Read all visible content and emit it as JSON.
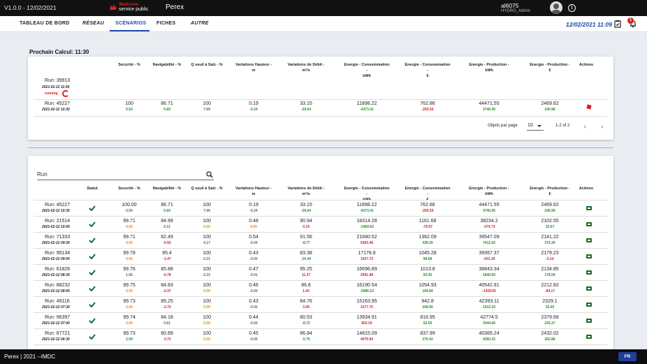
{
  "topbar": {
    "version": "V1.0.0 - 12/02/2021",
    "logo_line1": "Wallonie",
    "logo_line2": "service public",
    "app_name": "Perex",
    "user": "al6075",
    "role": "HYDRO_Admin"
  },
  "nav": {
    "tabs": [
      {
        "label": "TABLEAU DE BORD"
      },
      {
        "label": "RÉSEAU"
      },
      {
        "label": "SCÉNARIOS"
      },
      {
        "label": "FICHES"
      },
      {
        "label": "AUTRE"
      }
    ],
    "datetime": "12/02/2021 11:09",
    "notification_count": "1"
  },
  "page_title": "Prochain Calcul: 11:30",
  "columns": [
    "Securité - %",
    "Navigabilité - %",
    "Q seuil à Salz - %",
    "Variations Hauteur - m",
    "Variations de Débit - m³/s",
    "Energie - Consommation - kWh",
    "Energie - Consommation - €",
    "Energie - Production - kWh",
    "Energie - Production - €"
  ],
  "actions_header": "Actions",
  "status_header": "Statut",
  "upcoming": {
    "pending_run": {
      "name": "Run: 39913",
      "date": "2021-02-12 11:00",
      "status": "running"
    },
    "rows": [
      {
        "name": "Run: 45227",
        "date": "2021-02-12 10:30",
        "cells": [
          [
            "100",
            "0.50",
            "green"
          ],
          [
            "86.71",
            "5.69",
            "green"
          ],
          [
            "100",
            "7.99",
            "green"
          ],
          [
            "0.19",
            "-0.24",
            "green"
          ],
          [
            "33.15",
            "-29.64",
            "green"
          ],
          [
            "11898.22",
            "-4373.41",
            "green"
          ],
          [
            "762.86",
            "-265.55",
            "red"
          ],
          [
            "44471.55",
            "3740.05",
            "green"
          ],
          [
            "2469.62",
            "240.96",
            "green"
          ]
        ]
      }
    ],
    "pager": {
      "label": "Objets par page",
      "per_page": "10",
      "range": "1-2 of 2"
    }
  },
  "search": {
    "placeholder": "Run"
  },
  "history": {
    "rows": [
      {
        "name": "Run: 45227",
        "date": "2021-02-12 10:30",
        "cells": [
          [
            "100.00",
            "0.50",
            "green"
          ],
          [
            "86.71",
            "5.69",
            "green"
          ],
          [
            "100",
            "7.99",
            "green"
          ],
          [
            "0.19",
            "-0.24",
            "green"
          ],
          [
            "33.15",
            "-29.64",
            "green"
          ],
          [
            "11898.22",
            "-4373.41",
            "green"
          ],
          [
            "762.86",
            "-265.55",
            "red"
          ],
          [
            "44471.55",
            "3740.05",
            "green"
          ],
          [
            "2469.62",
            "240.96",
            "green"
          ]
        ]
      },
      {
        "name": "Run: 21514",
        "date": "2021-02-12 10:00",
        "cells": [
          [
            "99.71",
            "0.00",
            "orange"
          ],
          [
            "84.99",
            "0.11",
            "green"
          ],
          [
            "100",
            "0.00",
            "orange"
          ],
          [
            "0.48",
            "0.00",
            "orange"
          ],
          [
            "90.94",
            "0.19",
            "red"
          ],
          [
            "18314.28",
            "-1469.83",
            "green"
          ],
          [
            "1161.68",
            "-76.67",
            "red"
          ],
          [
            "38234.2",
            "-374.73",
            "red"
          ],
          [
            "2102.55",
            "32.67",
            "green"
          ]
        ]
      },
      {
        "name": "Run: 71333",
        "date": "2021-02-12 09:30",
        "cells": [
          [
            "99.71",
            "0.00",
            "orange"
          ],
          [
            "82.49",
            "-0.55",
            "red"
          ],
          [
            "100",
            "4.17",
            "green"
          ],
          [
            "0.54",
            "-0.04",
            "green"
          ],
          [
            "91.56",
            "-8.77",
            "green"
          ],
          [
            "21680.52",
            "6363.46",
            "red"
          ],
          [
            "1362.09",
            "438.29",
            "green"
          ],
          [
            "39547.09",
            "7412.02",
            "green"
          ],
          [
            "2141.22",
            "372.20",
            "green"
          ]
        ]
      },
      {
        "name": "Run: 95134",
        "date": "2021-02-12 09:00",
        "cells": [
          [
            "99.78",
            "0.00",
            "orange"
          ],
          [
            "85.4",
            "-1.47",
            "red"
          ],
          [
            "100",
            "0.21",
            "green"
          ],
          [
            "0.43",
            "-0.02",
            "green"
          ],
          [
            "83.38",
            "-10.44",
            "green"
          ],
          [
            "17178.8",
            "1527.72",
            "red"
          ],
          [
            "1045.28",
            "99.68",
            "green"
          ],
          [
            "39367.37",
            "-431.35",
            "red"
          ],
          [
            "2179.23",
            "-0.10",
            "red"
          ]
        ]
      },
      {
        "name": "Run: 61826",
        "date": "2021-02-12 08:30",
        "cells": [
          [
            "99.76",
            "1.56",
            "green"
          ],
          [
            "85.88",
            "-0.78",
            "red"
          ],
          [
            "100",
            "2.22",
            "green"
          ],
          [
            "0.47",
            "-0.01",
            "green"
          ],
          [
            "95.25",
            "11.37",
            "red"
          ],
          [
            "16696.89",
            "2591.98",
            "red"
          ],
          [
            "1013.8",
            "93.45",
            "green"
          ],
          [
            "38843.34",
            "1840.65",
            "green"
          ],
          [
            "2134.85",
            "178.00",
            "green"
          ]
        ]
      },
      {
        "name": "Run: 88232",
        "date": "2021-02-12 08:00",
        "cells": [
          [
            "99.75",
            "0.00",
            "orange"
          ],
          [
            "84.83",
            "-0.37",
            "red"
          ],
          [
            "100",
            "0.00",
            "orange"
          ],
          [
            "0.46",
            "-0.03",
            "green"
          ],
          [
            "86.8",
            "1.43",
            "red"
          ],
          [
            "16190.54",
            "-2986.10",
            "green"
          ],
          [
            "1054.93",
            "194.84",
            "green"
          ],
          [
            "40542.91",
            "-1429.60",
            "red"
          ],
          [
            "2212.82",
            "-84.17",
            "red"
          ]
        ]
      },
      {
        "name": "Run: 49116",
        "date": "2021-02-12 07:30",
        "cells": [
          [
            "99.73",
            "0.00",
            "orange"
          ],
          [
            "85.25",
            "-2.70",
            "red"
          ],
          [
            "100",
            "0.00",
            "orange"
          ],
          [
            "0.43",
            "-0.02",
            "green"
          ],
          [
            "84.76",
            "3.08",
            "red"
          ],
          [
            "15163.95",
            "3177.75",
            "red"
          ],
          [
            "942.8",
            "208.90",
            "green"
          ],
          [
            "42393.11",
            "1013.33",
            "green"
          ],
          [
            "2329.1",
            "32.45",
            "green"
          ]
        ]
      },
      {
        "name": "Run: 96397",
        "date": "2021-02-12 07:00",
        "cells": [
          [
            "99.74",
            "0.00",
            "orange"
          ],
          [
            "84.18",
            "0.61",
            "green"
          ],
          [
            "100",
            "0.00",
            "orange"
          ],
          [
            "0.44",
            "-0.04",
            "green"
          ],
          [
            "80.53",
            "-8.72",
            "green"
          ],
          [
            "13934.91",
            "853.03",
            "red"
          ],
          [
            "816.95",
            "52.50",
            "green"
          ],
          [
            "42774.5",
            "3344.66",
            "green"
          ],
          [
            "2379.68",
            "243.27",
            "green"
          ]
        ]
      },
      {
        "name": "Run: 87721",
        "date": "2021-02-12 06:30",
        "cells": [
          [
            "99.73",
            "2.09",
            "green"
          ],
          [
            "80.89",
            "-3.72",
            "red"
          ],
          [
            "100",
            "0.00",
            "orange"
          ],
          [
            "0.45",
            "-0.05",
            "green"
          ],
          [
            "86.84",
            "-5.70",
            "green"
          ],
          [
            "14815.09",
            "4079.94",
            "red"
          ],
          [
            "837.99",
            "270.43",
            "green"
          ],
          [
            "40365.24",
            "4260.32",
            "green"
          ],
          [
            "2432.02",
            "262.86",
            "green"
          ]
        ]
      }
    ]
  },
  "footer": {
    "text": "Perex | 2021 --IMDC",
    "lang": "FR"
  },
  "colors": {
    "accent": "#1f4aa8",
    "positive": "#2a8a2a",
    "negative": "#d82020",
    "neutral": "#e88a00"
  }
}
